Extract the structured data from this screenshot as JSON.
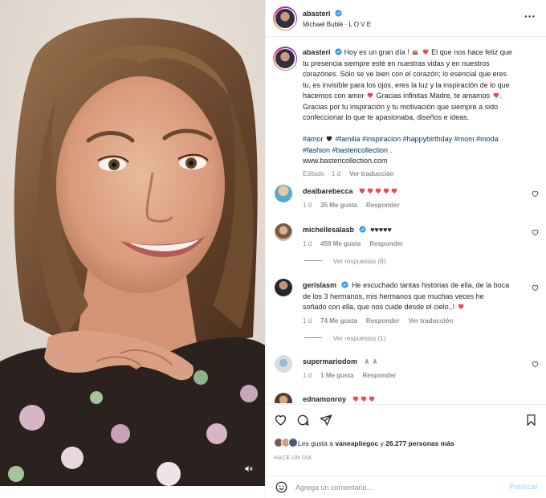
{
  "post": {
    "author": "abasteri",
    "audio": "Michael Bublé · L O V E",
    "caption": {
      "username": "abasteri",
      "line1": "Hoy es un gran día !",
      "line1b": "El que nos hace feliz que",
      "line2": "tu presencia siempre esté en nuestras vidas y en nuestros",
      "line3": "corazónes. Sólo se ve bien con el corazón; lo esencial que eres",
      "line4": "tu, es invisible para los ojos, eres la luz y la inspiración de lo que",
      "line5a": "hacemos con amor",
      "line5b": "Gracias infinitas Madre, te amamos",
      "line6": "Gracias por tu inspiración y tu motivación que siempre a sido",
      "line7": "confeccionar lo que te apasionaba, diseños e ideas.",
      "hashtags1": "#amor",
      "hashtags2": "#familia #inspiracion #happybirthday #mom #moda",
      "hashtags3": "#fashion #bastericollection .",
      "url": "www.bastericollection.com",
      "edited": "Editado",
      "time": "1 d",
      "translate": "Ver traducción"
    }
  },
  "comments": [
    {
      "username": "dealbarebecca",
      "time": "1 d",
      "likes": "35 Me gusta",
      "reply": "Responder"
    },
    {
      "username": "michellesalasb",
      "text": "♥♥♥♥♥",
      "time": "1 d",
      "likes": "459 Me gusta",
      "reply": "Responder",
      "view_replies": "Ver respuestas (8)"
    },
    {
      "username": "gerislasm",
      "line1": "He escuchado tantas historias de ella, de la boca",
      "line2": "de los 3 hermanos, mis hermanos que muchas veces he",
      "line3": "soñado con ella, que nos cuide desde el cielo..!",
      "time": "1 d",
      "likes": "74 Me gusta",
      "reply": "Responder",
      "translate": "Ver traducción",
      "view_replies": "Ver respuestas (1)"
    },
    {
      "username": "supermariodom",
      "time": "1 d",
      "likes": "1 Me gusta",
      "reply": "Responder"
    },
    {
      "username": "ednamonroy"
    }
  ],
  "likes_summary": {
    "prefix": "Les gusta a",
    "user": "vaneapliegoc",
    "middle": "y",
    "count": "26.277 personas más"
  },
  "time_ago": "HACE UN DÍA",
  "add_comment": {
    "placeholder": "Agrega un comentario...",
    "publish": "Publicar"
  },
  "icons": {
    "more": "more-options-icon",
    "like": "heart-icon",
    "comment": "comment-icon",
    "share": "share-icon",
    "save": "bookmark-icon",
    "emoji": "emoji-icon",
    "mute": "mute-icon",
    "verified": "verified-badge-icon"
  },
  "colors": {
    "heart_red": "#ed4956",
    "verified_blue": "#3897f0",
    "link": "#00376b",
    "publish": "#b2dffc"
  }
}
